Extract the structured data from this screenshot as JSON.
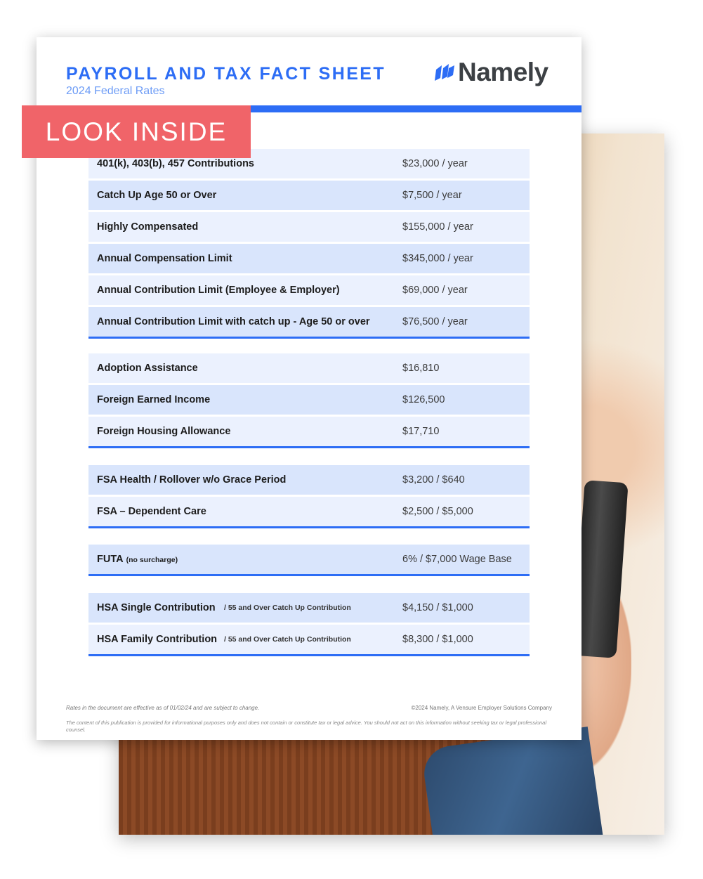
{
  "header": {
    "title": "PAYROLL AND TAX FACT SHEET",
    "subtitle": "2024 Federal Rates",
    "logo_text": "Namely",
    "accent_color": "#2d6df5"
  },
  "badge": {
    "label": "LOOK INSIDE",
    "color": "#f06469"
  },
  "groups": [
    {
      "rows": [
        {
          "label": "401(k), 403(b), 457 Contributions",
          "value": "$23,000 / year"
        },
        {
          "label": "Catch Up Age 50 or Over",
          "value": "$7,500 / year"
        },
        {
          "label": "Highly Compensated",
          "value": "$155,000 / year"
        },
        {
          "label": "Annual Compensation Limit",
          "value": "$345,000 / year"
        },
        {
          "label": "Annual Contribution Limit (Employee & Employer)",
          "value": "$69,000 / year"
        },
        {
          "label": "Annual Contribution Limit with catch up - Age 50 or over",
          "value": "$76,500 / year"
        }
      ]
    },
    {
      "rows": [
        {
          "label": "Adoption Assistance",
          "value": "$16,810"
        },
        {
          "label": "Foreign Earned Income",
          "value": "$126,500"
        },
        {
          "label": "Foreign Housing Allowance",
          "value": "$17,710"
        }
      ]
    },
    {
      "rows": [
        {
          "label": "FSA Health / Rollover w/o Grace Period",
          "value": "$3,200 / $640"
        },
        {
          "label": "FSA – Dependent Care",
          "value": "$2,500 / $5,000"
        }
      ]
    },
    {
      "rows": [
        {
          "label": "FUTA",
          "note": "(no surcharge)",
          "value": "6% / $7,000 Wage Base"
        }
      ]
    },
    {
      "rows": [
        {
          "label": "HSA Single Contribution",
          "sub": "/ 55 and Over Catch Up Contribution",
          "value": "$4,150 / $1,000"
        },
        {
          "label": "HSA Family Contribution",
          "sub": "/ 55 and Over Catch Up Contribution",
          "value": "$8,300 / $1,000"
        }
      ]
    }
  ],
  "footer": {
    "effective_note": "Rates in the document are effective as of 01/02/24 and are subject to change.",
    "copyright": "©2024 Namely, A Vensure Employer Solutions Company",
    "disclaimer": "The content of this publication is provided for informational purposes only and does not contain or constitute tax or legal advice. You should not act on this information without seeking tax or legal professional counsel."
  }
}
